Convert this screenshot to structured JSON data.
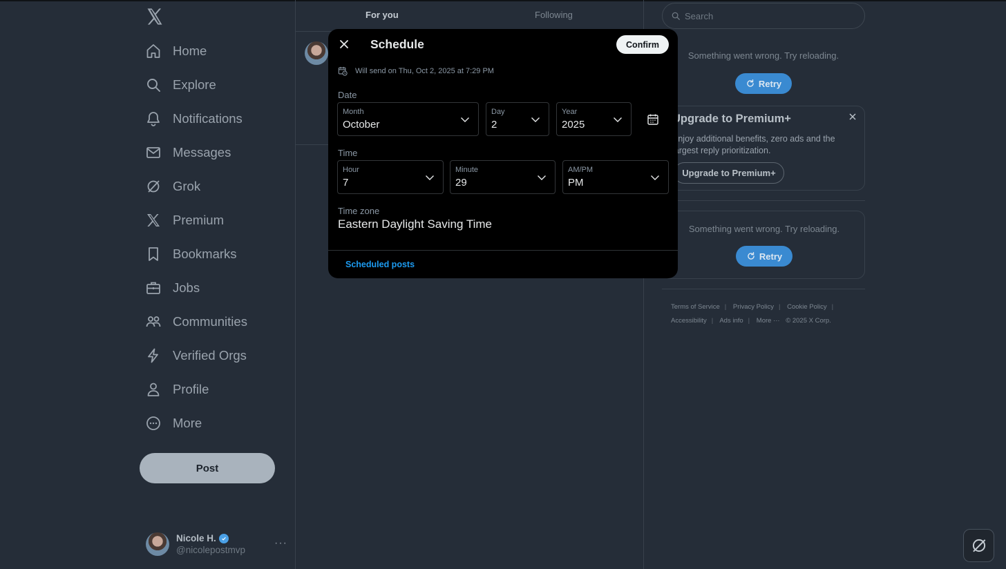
{
  "nav": {
    "logo_icon": "x-logo-icon",
    "items": [
      {
        "label": "Home",
        "icon": "home-icon"
      },
      {
        "label": "Explore",
        "icon": "search-icon"
      },
      {
        "label": "Notifications",
        "icon": "bell-icon"
      },
      {
        "label": "Messages",
        "icon": "mail-icon"
      },
      {
        "label": "Grok",
        "icon": "grok-icon"
      },
      {
        "label": "Premium",
        "icon": "x-logo-icon"
      },
      {
        "label": "Bookmarks",
        "icon": "bookmark-icon"
      },
      {
        "label": "Jobs",
        "icon": "briefcase-icon"
      },
      {
        "label": "Communities",
        "icon": "people-icon"
      },
      {
        "label": "Verified Orgs",
        "icon": "lightning-icon"
      },
      {
        "label": "Profile",
        "icon": "person-icon"
      },
      {
        "label": "More",
        "icon": "more-circle-icon"
      }
    ],
    "post_label": "Post"
  },
  "account": {
    "name": "Nicole H.",
    "handle": "@nicolepostmvp",
    "more": "···"
  },
  "timeline": {
    "tabs": [
      "For you",
      "Following"
    ]
  },
  "right": {
    "search_placeholder": "Search",
    "error_text": "Something went wrong. Try reloading.",
    "retry_label": "Retry",
    "premium": {
      "title": "Upgrade to Premium+",
      "description": "Enjoy additional benefits, zero ads and the largest reply prioritization.",
      "button": "Upgrade to Premium+"
    },
    "footer": {
      "links": [
        "Terms of Service",
        "Privacy Policy",
        "Cookie Policy",
        "Accessibility",
        "Ads info",
        "More ···"
      ],
      "copyright": "© 2025 X Corp."
    }
  },
  "modal": {
    "title": "Schedule",
    "confirm_label": "Confirm",
    "will_send": "Will send on Thu, Oct 2, 2025 at 7:29 PM",
    "date_label": "Date",
    "month": {
      "label": "Month",
      "value": "October"
    },
    "day": {
      "label": "Day",
      "value": "2"
    },
    "year": {
      "label": "Year",
      "value": "2025"
    },
    "time_label": "Time",
    "hour": {
      "label": "Hour",
      "value": "7"
    },
    "minute": {
      "label": "Minute",
      "value": "29"
    },
    "ampm": {
      "label": "AM/PM",
      "value": "PM"
    },
    "timezone_label": "Time zone",
    "timezone_value": "Eastern Daylight Saving Time",
    "scheduled_posts_link": "Scheduled posts"
  },
  "colors": {
    "background": "#252d38",
    "modal_background": "#000000",
    "accent_blue": "#1d9bf0",
    "retry_blue": "#3a8ad1",
    "post_button": "#a9b3bd"
  }
}
